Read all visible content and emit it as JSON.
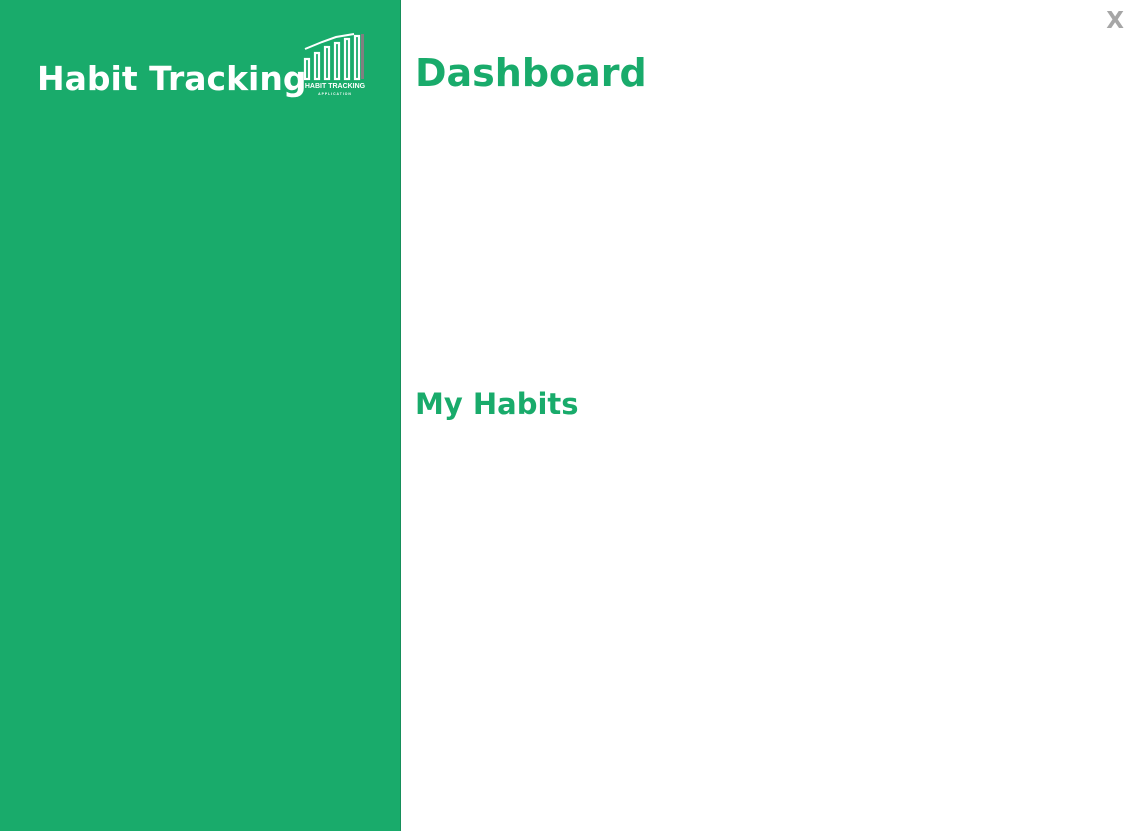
{
  "sidebar": {
    "brand_title": "Habit Tracking",
    "logo": {
      "icon": "bar-chart-logo-icon",
      "line1": "HABIT TRACKING",
      "line2": "APPLICATION"
    }
  },
  "window": {
    "close_label": "X"
  },
  "main": {
    "page_title": "Dashboard",
    "habits_heading": "My Habits"
  },
  "colors": {
    "brand_green": "#19ab6b",
    "close_gray": "#a6a6a6",
    "background": "#ffffff"
  }
}
